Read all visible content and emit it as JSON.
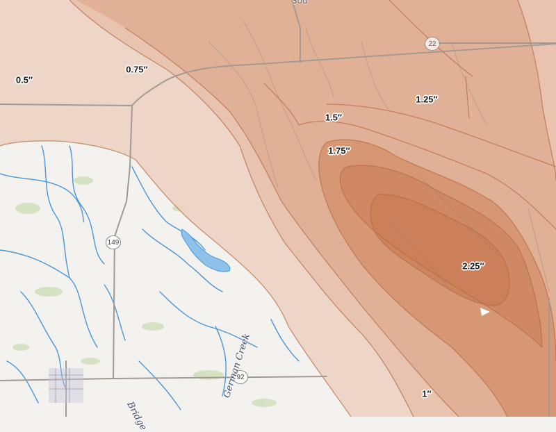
{
  "map": {
    "colors": {
      "base": "#f4f2ef",
      "water": "#4a95d6",
      "lake": "#8ec2ea",
      "vegetation": "#c9dcb0",
      "road": "#a29a92",
      "band_0_5": "#ecd2c2",
      "band_1": "#e6c1ab",
      "band_1_25": "#ddab8e",
      "band_1_75": "#d4916b",
      "band_2": "#cf8561",
      "contour_line": "#b56a43"
    },
    "contour_labels": {
      "l_0_5": "0.5″",
      "l_0_75": "0.75″",
      "l_1": "1″",
      "l_1_25": "1.25″",
      "l_1_5": "1.5″",
      "l_1_75": "1.75″",
      "l_2_25": "2.25″"
    },
    "route_shields": {
      "r22": "22",
      "r149": "149",
      "r92": "92"
    },
    "place_labels": {
      "creek": "German Creek",
      "bridge": "Bridge",
      "top_partial": "Sou"
    }
  }
}
